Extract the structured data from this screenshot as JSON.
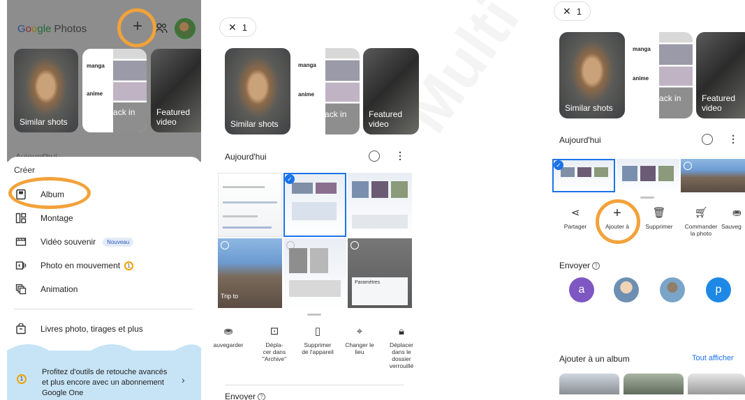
{
  "watermark": "Multi",
  "panel1": {
    "app_title": {
      "G": "G",
      "o1": "o",
      "o2": "o",
      "gle": "gle",
      "rest": " Photos"
    },
    "cards": [
      {
        "label": "Similar shots"
      },
      {
        "label": "Look back in time",
        "top_text": "manga",
        "mid_text": "anime"
      },
      {
        "label": "Featured video"
      }
    ],
    "partial_section": "Aujourd'hui",
    "create_heading": "Créer",
    "menu": [
      {
        "icon": "album-icon",
        "label": "Album"
      },
      {
        "icon": "collage-icon",
        "label": "Montage"
      },
      {
        "icon": "movie-icon",
        "label": "Vidéo souvenir",
        "badge": "Nouveau"
      },
      {
        "icon": "motion-photo-icon",
        "label": "Photo en mouvement",
        "badge_icon": "google-one-icon"
      },
      {
        "icon": "animation-icon",
        "label": "Animation"
      }
    ],
    "photo_books": "Livres photo, tirages et plus",
    "promo_text": "Profitez d'outils de retouche avancés et plus encore avec un abonnement Google One"
  },
  "panel2": {
    "selection_count": "1",
    "cards": [
      {
        "label": "Similar shots"
      },
      {
        "label": "Look back in time",
        "top_text": "manga",
        "mid_text": "anime"
      },
      {
        "label": "Featured video"
      }
    ],
    "section_title": "Aujourd'hui",
    "thumb_caption": "Trip to",
    "settings_caption": "Paramètres",
    "actions": [
      {
        "icon": "backup-icon",
        "label": "auvegarder"
      },
      {
        "icon": "archive-icon",
        "label": "Dépla-\ncer dans\n\"Archive\""
      },
      {
        "icon": "delete-device-icon",
        "label": "Supprimer\nde l'appareil"
      },
      {
        "icon": "location-icon",
        "label": "Changer le\nlieu"
      },
      {
        "icon": "lock-icon",
        "label": "Déplacer\ndans le\ndossier\nverrouillé"
      }
    ],
    "envoyer": "Envoyer"
  },
  "panel3": {
    "selection_count": "1",
    "cards": [
      {
        "label": "Similar shots"
      },
      {
        "label": "Look back in time",
        "top_text": "manga",
        "mid_text": "anime"
      },
      {
        "label": "Featured video"
      }
    ],
    "section_title": "Aujourd'hui",
    "actions": [
      {
        "icon": "share-icon",
        "label": "Partager"
      },
      {
        "icon": "add-icon",
        "label": "Ajouter à"
      },
      {
        "icon": "trash-icon",
        "label": "Supprimer"
      },
      {
        "icon": "cart-icon",
        "label": "Commander\nla photo"
      },
      {
        "icon": "backup-icon",
        "label": "Sauveg"
      }
    ],
    "envoyer": "Envoyer",
    "contacts": [
      {
        "initial": "a",
        "color": "#7e57c2"
      },
      {
        "initial": ""
      },
      {
        "initial": ""
      },
      {
        "initial": "p",
        "color": "#1e88e5"
      }
    ],
    "add_to_album": "Ajouter à un album",
    "see_all": "Tout afficher"
  },
  "highlight_color": "#f2a23a"
}
